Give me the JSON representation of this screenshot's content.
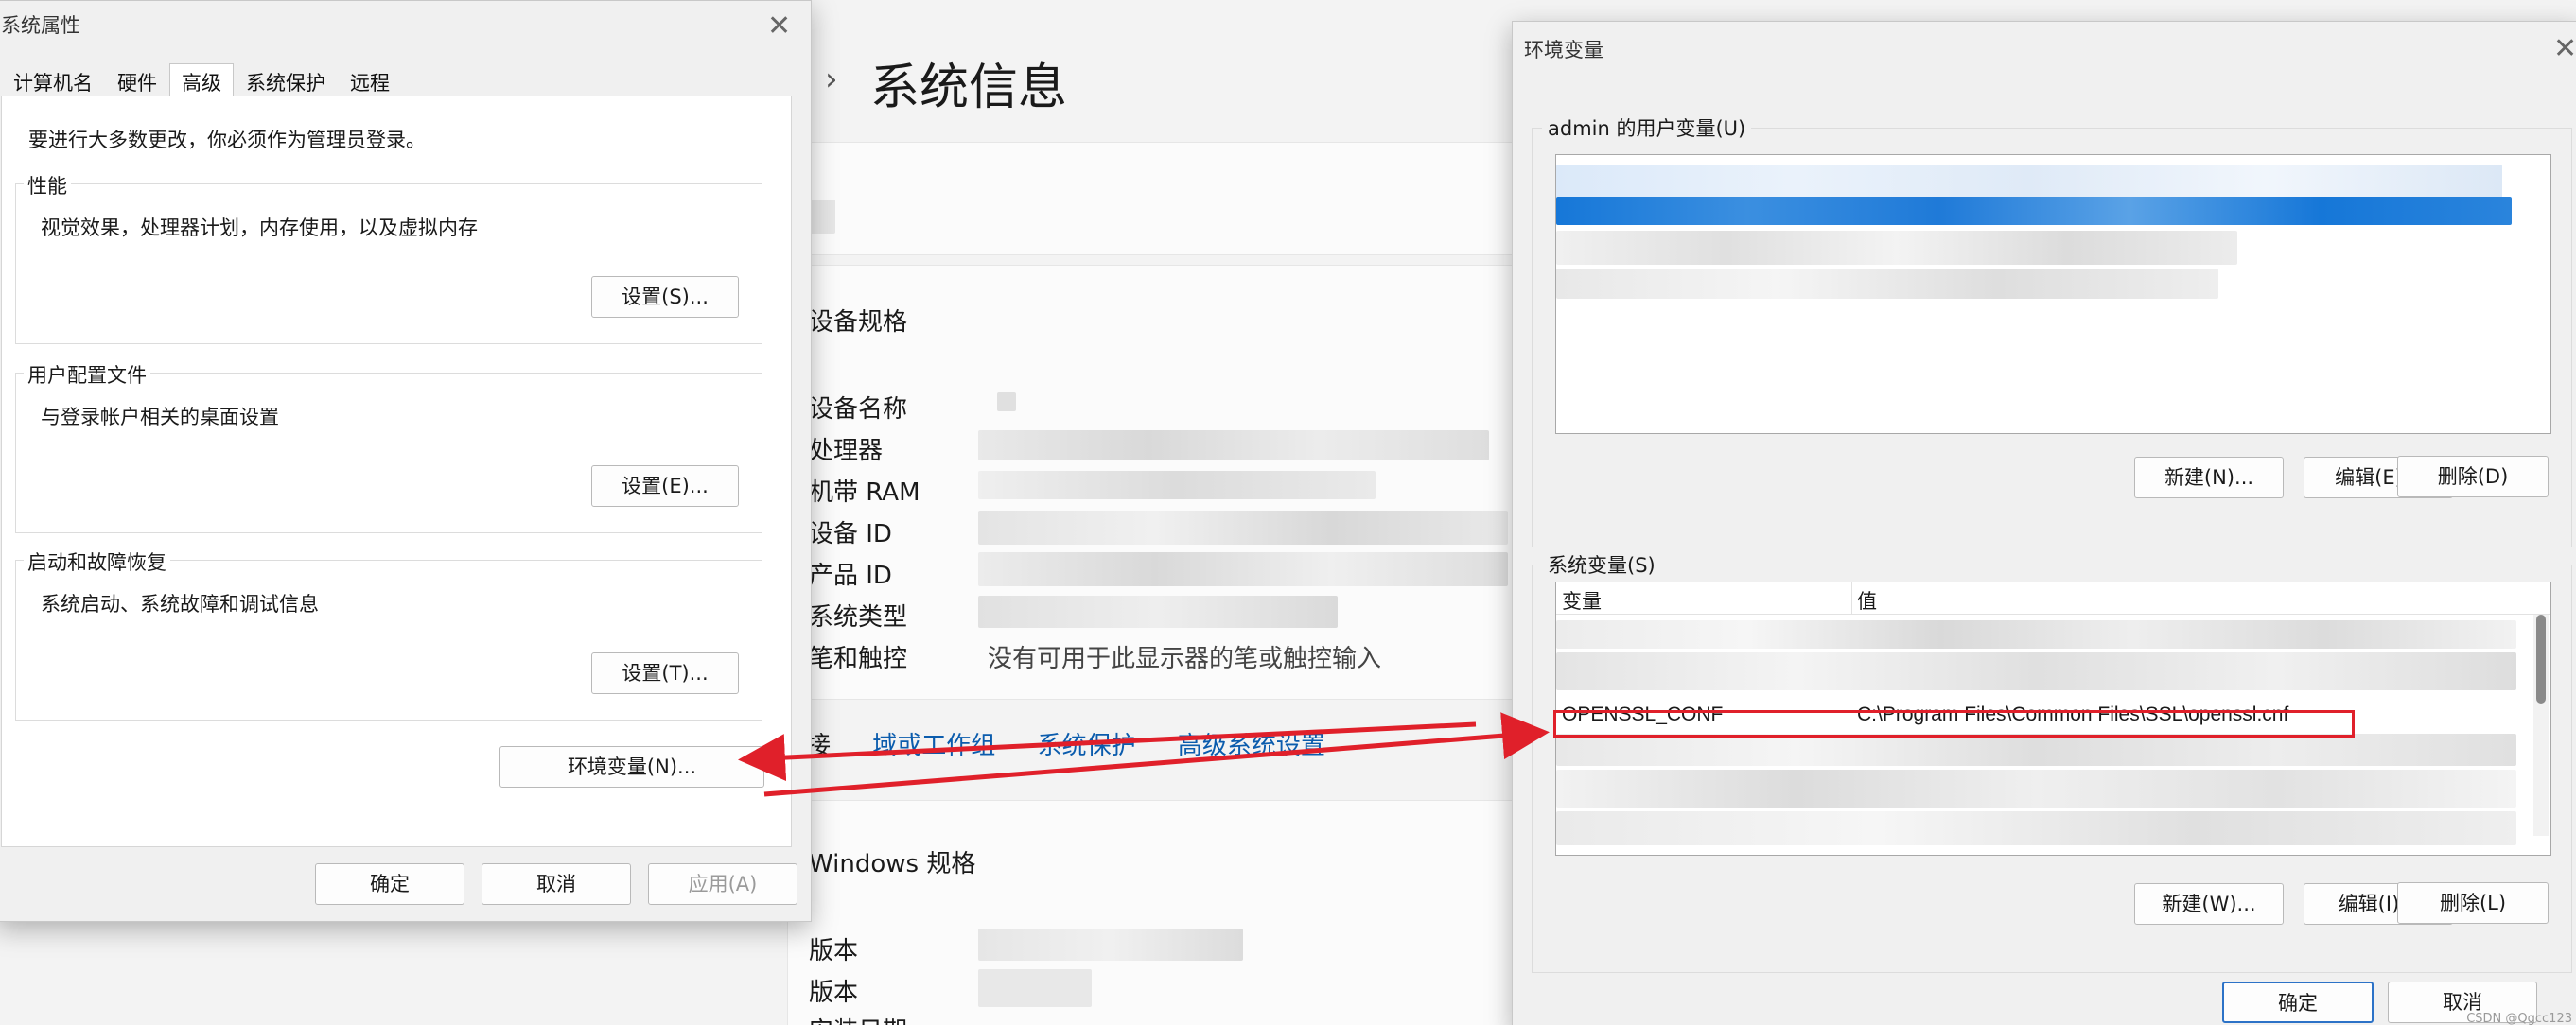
{
  "settings_page": {
    "title": "系统信息",
    "sections": {
      "device_spec": "设备规格",
      "windows_spec": "Windows 规格"
    },
    "device_rows": [
      "设备名称",
      "处理器",
      "机带 RAM",
      "设备 ID",
      "产品 ID",
      "系统类型",
      "笔和触控"
    ],
    "pen_touch_value": "没有可用于此显示器的笔或触控输入",
    "related_links": {
      "prefix": "接",
      "domain": "域或工作组",
      "protection": "系统保护",
      "advanced": "高级系统设置"
    },
    "windows_rows": [
      "版本",
      "版本",
      "安装日期"
    ]
  },
  "sysprops": {
    "title": "系统属性",
    "tabs": [
      "计算机名",
      "硬件",
      "高级",
      "系统保护",
      "远程"
    ],
    "active_tab": "高级",
    "notice": "要进行大多数更改，你必须作为管理员登录。",
    "groups": [
      {
        "legend": "性能",
        "description": "视觉效果，处理器计划，内存使用，以及虚拟内存",
        "button": "设置(S)..."
      },
      {
        "legend": "用户配置文件",
        "description": "与登录帐户相关的桌面设置",
        "button": "设置(E)..."
      },
      {
        "legend": "启动和故障恢复",
        "description": "系统启动、系统故障和调试信息",
        "button": "设置(T)..."
      }
    ],
    "env_button": "环境变量(N)...",
    "ok": "确定",
    "cancel": "取消",
    "apply": "应用(A)"
  },
  "envvars": {
    "title": "环境变量",
    "user_section": "admin 的用户变量(U)",
    "user_buttons": {
      "new": "新建(N)...",
      "edit": "编辑(E)...",
      "delete": "删除(D)"
    },
    "system_section": "系统变量(S)",
    "columns": {
      "variable": "变量",
      "value": "值"
    },
    "highlighted_row": {
      "variable": "OPENSSL_CONF",
      "value": "C:\\Program Files\\Common Files\\SSL\\openssl.cnf"
    },
    "system_buttons": {
      "new": "新建(W)...",
      "edit": "编辑(I)...",
      "delete": "删除(L)"
    },
    "ok": "确定",
    "cancel": "取消"
  },
  "watermark": "CSDN @Qgcc123",
  "colors": {
    "annotation_red": "#e0202a",
    "link_blue": "#0b5cad",
    "selection_blue": "#1677d8"
  }
}
